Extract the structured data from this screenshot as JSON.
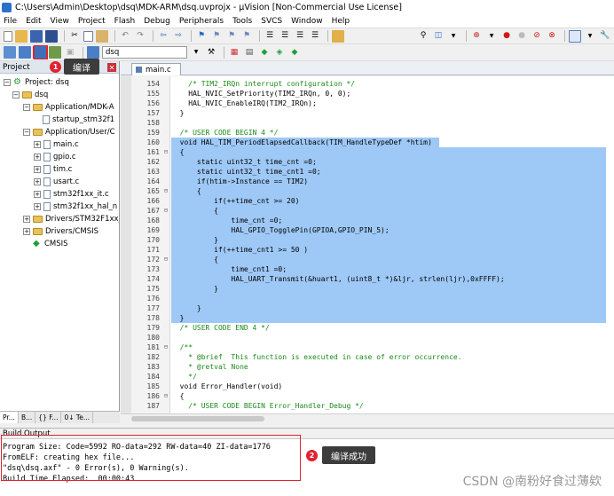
{
  "window": {
    "title": "C:\\Users\\Admin\\Desktop\\dsq\\MDK-ARM\\dsq.uvprojx - µVision [Non-Commercial Use License]"
  },
  "menu": [
    "File",
    "Edit",
    "View",
    "Project",
    "Flash",
    "Debug",
    "Peripherals",
    "Tools",
    "SVCS",
    "Window",
    "Help"
  ],
  "toolbar": {
    "target_value": "dsq"
  },
  "project": {
    "panel_title": "Project",
    "root": "Project: dsq",
    "target": "dsq",
    "groups": [
      {
        "name": "Application/MDK-A",
        "files": [
          "startup_stm32f1"
        ]
      },
      {
        "name": "Application/User/C",
        "files": [
          "main.c",
          "gpio.c",
          "tim.c",
          "usart.c",
          "stm32f1xx_it.c",
          "stm32f1xx_hal_n"
        ]
      },
      {
        "name": "Drivers/STM32F1xx_",
        "files": []
      },
      {
        "name": "Drivers/CMSIS",
        "files": []
      }
    ],
    "cmsis": "CMSIS",
    "bottom_tabs": [
      "Pr...",
      "B...",
      "{} F...",
      "0↓ Te..."
    ]
  },
  "editor": {
    "active_tab": "main.c",
    "lines": [
      {
        "n": "154",
        "code": "    /* TIM2_IRQn interrupt configuration */",
        "cls": "cmt",
        "hl": false,
        "fold": ""
      },
      {
        "n": "155",
        "code": "    HAL_NVIC_SetPriority(TIM2_IRQn, 0, 0);",
        "cls": "",
        "hl": false,
        "fold": ""
      },
      {
        "n": "156",
        "code": "    HAL_NVIC_EnableIRQ(TIM2_IRQn);",
        "cls": "",
        "hl": false,
        "fold": ""
      },
      {
        "n": "157",
        "code": "  }",
        "cls": "",
        "hl": false,
        "fold": ""
      },
      {
        "n": "158",
        "code": "",
        "cls": "",
        "hl": false,
        "fold": ""
      },
      {
        "n": "159",
        "code": "  /* USER CODE BEGIN 4 */",
        "cls": "cmt",
        "hl": false,
        "fold": ""
      },
      {
        "n": "160",
        "code": "  void HAL_TIM_PeriodElapsedCallback(TIM_HandleTypeDef *htim)",
        "cls": "",
        "hl": true,
        "fold": ""
      },
      {
        "n": "161",
        "code": "  {",
        "cls": "",
        "hl": true,
        "fold": "⊟"
      },
      {
        "n": "162",
        "code": "      static uint32_t time_cnt =0;",
        "cls": "",
        "hl": true,
        "fold": ""
      },
      {
        "n": "163",
        "code": "      static uint32_t time_cnt1 =0;",
        "cls": "",
        "hl": true,
        "fold": ""
      },
      {
        "n": "164",
        "code": "      if(htim->Instance == TIM2)",
        "cls": "",
        "hl": true,
        "fold": ""
      },
      {
        "n": "165",
        "code": "      {",
        "cls": "",
        "hl": true,
        "fold": "⊟"
      },
      {
        "n": "166",
        "code": "          if(++time_cnt >= 20)",
        "cls": "",
        "hl": true,
        "fold": ""
      },
      {
        "n": "167",
        "code": "          {",
        "cls": "",
        "hl": true,
        "fold": "⊟"
      },
      {
        "n": "168",
        "code": "              time_cnt =0;",
        "cls": "",
        "hl": true,
        "fold": ""
      },
      {
        "n": "169",
        "code": "              HAL_GPIO_TogglePin(GPIOA,GPIO_PIN_5);",
        "cls": "",
        "hl": true,
        "fold": ""
      },
      {
        "n": "170",
        "code": "          }",
        "cls": "",
        "hl": true,
        "fold": ""
      },
      {
        "n": "171",
        "code": "          if(++time_cnt1 >= 50 )",
        "cls": "",
        "hl": true,
        "fold": ""
      },
      {
        "n": "172",
        "code": "          {",
        "cls": "",
        "hl": true,
        "fold": "⊟"
      },
      {
        "n": "173",
        "code": "              time_cnt1 =0;",
        "cls": "",
        "hl": true,
        "fold": ""
      },
      {
        "n": "174",
        "code": "              HAL_UART_Transmit(&huart1, (uint8_t *)&ljr, strlen(ljr),0xFFFF);",
        "cls": "",
        "hl": true,
        "fold": ""
      },
      {
        "n": "175",
        "code": "          }",
        "cls": "",
        "hl": true,
        "fold": ""
      },
      {
        "n": "176",
        "code": "",
        "cls": "",
        "hl": true,
        "fold": ""
      },
      {
        "n": "177",
        "code": "      }",
        "cls": "",
        "hl": true,
        "fold": ""
      },
      {
        "n": "178",
        "code": "  }",
        "cls": "",
        "hl": true,
        "fold": ""
      },
      {
        "n": "179",
        "code": "  /* USER CODE END 4 */",
        "cls": "cmt",
        "hl": false,
        "fold": ""
      },
      {
        "n": "180",
        "code": "",
        "cls": "",
        "hl": false,
        "fold": ""
      },
      {
        "n": "181",
        "code": "  /**",
        "cls": "cmt",
        "hl": false,
        "fold": "⊟"
      },
      {
        "n": "182",
        "code": "    * @brief  This function is executed in case of error occurrence.",
        "cls": "cmt",
        "hl": false,
        "fold": ""
      },
      {
        "n": "183",
        "code": "    * @retval None",
        "cls": "cmt",
        "hl": false,
        "fold": ""
      },
      {
        "n": "184",
        "code": "    */",
        "cls": "cmt",
        "hl": false,
        "fold": ""
      },
      {
        "n": "185",
        "code": "  void Error_Handler(void)",
        "cls": "",
        "hl": false,
        "fold": ""
      },
      {
        "n": "186",
        "code": "  {",
        "cls": "",
        "hl": false,
        "fold": "⊟"
      },
      {
        "n": "187",
        "code": "    /* USER CODE BEGIN Error_Handler_Debug */",
        "cls": "cmt",
        "hl": false,
        "fold": ""
      }
    ]
  },
  "build": {
    "title": "Build Output",
    "lines": [
      "Program Size: Code=5992 RO-data=292 RW-data=40 ZI-data=1776",
      "FromELF: creating hex file...",
      "\"dsq\\dsq.axf\" - 0 Error(s), 0 Warning(s).",
      "Build Time Elapsed:  00:00:43"
    ]
  },
  "annotations": {
    "badge1": "1",
    "label1": "编译",
    "badge2": "2",
    "label2": "编译成功"
  },
  "watermark": "CSDN @南粉好食过薄欸"
}
